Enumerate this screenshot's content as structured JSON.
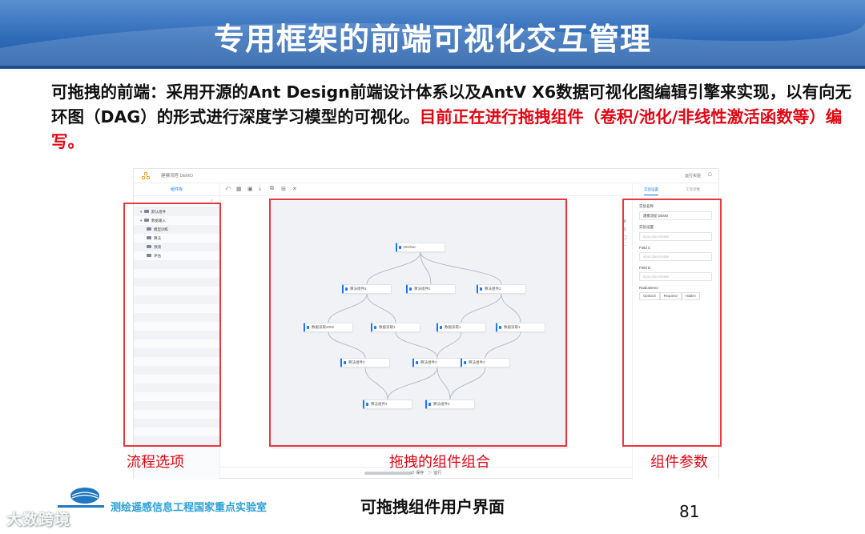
{
  "slide": {
    "title": "专用框架的前端可视化交互管理",
    "paragraph": {
      "part1": "可拖拽的前端：采用开源的Ant Design前端设计体系以及AntV X6数据可视化图编辑引擎来实现，以有向无环图（DAG）的形式进行深度学习模型的可视化。",
      "part2_red": "目前正在进行拖拽组件（卷积/池化/非线性激活函数等）编写。"
    },
    "caption": "可拖拽组件用户界面",
    "page_number": "81",
    "lab_name": "测绘遥感信息工程国家重点实验室",
    "watermark": "大数跨境",
    "accent_colors": {
      "header": "#2f6bb8",
      "red": "#e30613",
      "link": "#1677ff"
    }
  },
  "annotations": {
    "left": "流程选项",
    "center": "拖拽的组件组合",
    "right": "组件参数"
  },
  "app": {
    "project_name": "建模流程 DEMO",
    "top_right_label": "运行实验",
    "library_tab": "组件库",
    "tree": [
      {
        "label": "默认组件",
        "expanded": true,
        "sub": false
      },
      {
        "label": "数据输入",
        "expanded": true,
        "sub": false
      },
      {
        "label": "模型训练",
        "expanded": false,
        "sub": true
      },
      {
        "label": "算法",
        "expanded": false,
        "sub": true
      },
      {
        "label": "预测",
        "expanded": false,
        "sub": true
      },
      {
        "label": "评估",
        "expanded": false,
        "sub": true
      }
    ],
    "nodes": [
      {
        "id": "n0",
        "label": "Dis/Sec"
      },
      {
        "id": "n1",
        "label": "算法组件2"
      },
      {
        "id": "n2",
        "label": "算法组件2"
      },
      {
        "id": "n3",
        "label": "算法组件2"
      },
      {
        "id": "n4",
        "label": "数据读取2002"
      },
      {
        "id": "n5",
        "label": "数据读取1"
      },
      {
        "id": "n6",
        "label": "数据读取1"
      },
      {
        "id": "n7",
        "label": "数据读取1"
      },
      {
        "id": "n8",
        "label": "算法组件2"
      },
      {
        "id": "n9",
        "label": "算法组件2"
      },
      {
        "id": "n10",
        "label": "算法组件2"
      },
      {
        "id": "n11",
        "label": "算法组件3"
      },
      {
        "id": "n12",
        "label": "算法组件3"
      }
    ],
    "edges": [
      [
        "n0",
        "n1"
      ],
      [
        "n0",
        "n2"
      ],
      [
        "n0",
        "n3"
      ],
      [
        "n1",
        "n4"
      ],
      [
        "n1",
        "n5"
      ],
      [
        "n3",
        "n6"
      ],
      [
        "n3",
        "n7"
      ],
      [
        "n4",
        "n8"
      ],
      [
        "n5",
        "n9"
      ],
      [
        "n6",
        "n9"
      ],
      [
        "n7",
        "n10"
      ],
      [
        "n8",
        "n11"
      ],
      [
        "n9",
        "n11"
      ],
      [
        "n9",
        "n12"
      ],
      [
        "n10",
        "n12"
      ]
    ],
    "right_tabs": {
      "active": "实验设置",
      "inactive": "工作参数"
    },
    "form": {
      "exp_name_label": "实验名称",
      "exp_name_value": "建模流程 DEMO",
      "exp_setting_label": "实验设置",
      "placeholder": "input placeholder",
      "field_c_label": "Field C",
      "field_d_label": "Field D",
      "radio_label": "RadioDemo",
      "radio_options": [
        "Optional",
        "Required",
        "Hidden"
      ]
    },
    "bottom_actions": {
      "save": "保存",
      "run": "运行"
    }
  }
}
